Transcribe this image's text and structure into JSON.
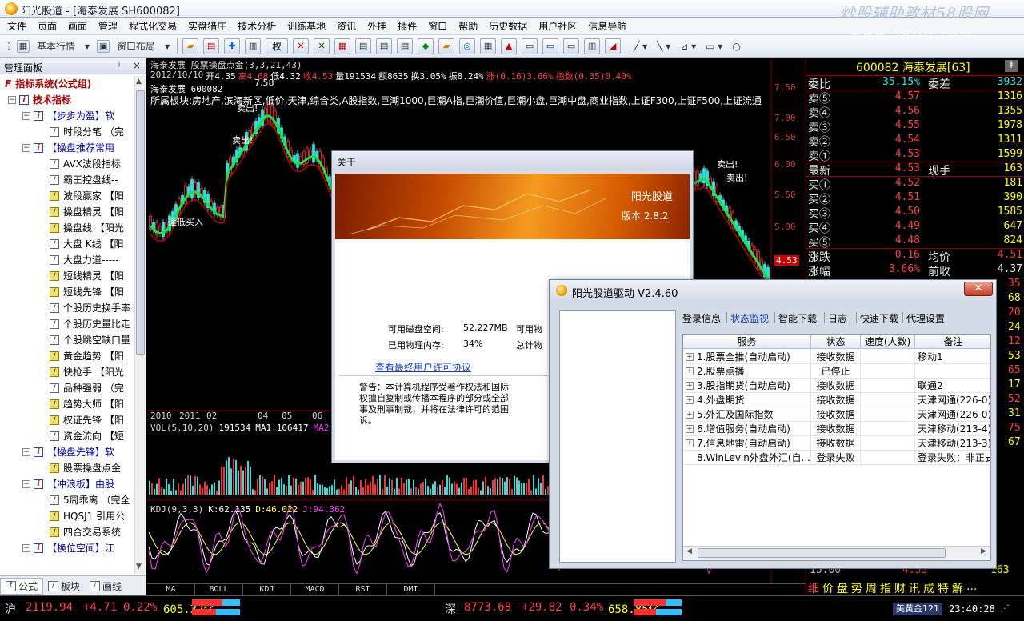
{
  "window": {
    "title": "阳光股道 - [海泰发展 SH600082]",
    "watermark1": "炒股辅助教材58股网",
    "watermark2": "www.58Gu.com"
  },
  "menu": [
    "文件",
    "页面",
    "画面",
    "管理",
    "程式化交易",
    "实盘猎庄",
    "技术分析",
    "训练基地",
    "资讯",
    "外挂",
    "插件",
    "窗口",
    "帮助",
    "历史数据",
    "用户社区",
    "信息导航"
  ],
  "toolbar": {
    "mode_label": "基本行情",
    "layout_label": "窗口布局",
    "quan_label": "权"
  },
  "left_panel": {
    "title": "管理面板",
    "pin": "ʲ",
    "close": "×",
    "tree": [
      {
        "label": "指标系统(公式组)",
        "level": 0,
        "icon": "F"
      },
      {
        "label": "技术指标",
        "level": 1,
        "icon": "i"
      },
      {
        "label": "【步步为盈】软",
        "level": 2,
        "icon": "i"
      },
      {
        "label": "时段分笔 （完",
        "level": 3,
        "icon": "box"
      },
      {
        "label": "【操盘推荐常用",
        "level": 2,
        "icon": "i"
      },
      {
        "label": "AVX波段指标",
        "level": 3,
        "icon": "box"
      },
      {
        "label": "霸王控盘线--",
        "level": 3,
        "icon": "box"
      },
      {
        "label": "波段赢家 【阳",
        "level": 3,
        "icon": "y"
      },
      {
        "label": "操盘精灵 【阳",
        "level": 3,
        "icon": "y"
      },
      {
        "label": "操盘线 【阳光",
        "level": 3,
        "icon": "y"
      },
      {
        "label": "大盘 K线 【阳",
        "level": 3,
        "icon": "box"
      },
      {
        "label": "大盘力道-----",
        "level": 3,
        "icon": "box"
      },
      {
        "label": "短线精灵 【阳",
        "level": 3,
        "icon": "y"
      },
      {
        "label": "短线先锋 【阳",
        "level": 3,
        "icon": "y"
      },
      {
        "label": "个股历史换手率",
        "level": 3,
        "icon": "box"
      },
      {
        "label": "个股历史量比走",
        "level": 3,
        "icon": "box"
      },
      {
        "label": "个股跳空缺口量",
        "level": 3,
        "icon": "box"
      },
      {
        "label": "黄金趋势 【阳",
        "level": 3,
        "icon": "y"
      },
      {
        "label": "快枪手 【阳光",
        "level": 3,
        "icon": "y"
      },
      {
        "label": "品种强弱 （完",
        "level": 3,
        "icon": "box"
      },
      {
        "label": "趋势大师 【阳",
        "level": 3,
        "icon": "y"
      },
      {
        "label": "权证先锋 【阳",
        "level": 3,
        "icon": "y"
      },
      {
        "label": "资金流向 【短",
        "level": 3,
        "icon": "box"
      },
      {
        "label": "【操盘先锋】软",
        "level": 2,
        "icon": "i"
      },
      {
        "label": "股票操盘点金",
        "level": 3,
        "icon": "y"
      },
      {
        "label": "【冲浪板】由股",
        "level": 2,
        "icon": "i"
      },
      {
        "label": "5周乖离 （完全",
        "level": 3,
        "icon": "box"
      },
      {
        "label": "HQSJ1 引用公",
        "level": 3,
        "icon": "y"
      },
      {
        "label": "四合交易系统",
        "level": 3,
        "icon": "y"
      },
      {
        "label": "【换位空间】江",
        "level": 2,
        "icon": "i"
      }
    ],
    "tabs": [
      "公式",
      "板块",
      "画线"
    ]
  },
  "chart": {
    "head1": "海泰发展  股票操盘点金(3,3,21,43)",
    "ohlc": [
      {
        "t": "2012/10/10",
        "c": "#d8d8d8"
      },
      {
        "t": "开4.35",
        "c": "#ffffff"
      },
      {
        "t": "高4.68",
        "c": "#ff4040"
      },
      {
        "t": "低4.32",
        "c": "#ffffff"
      },
      {
        "t": "收4.53",
        "c": "#ff4040"
      },
      {
        "t": "量191534",
        "c": "#ffffff"
      },
      {
        "t": "额8635",
        "c": "#ffffff"
      },
      {
        "t": "换3.05%",
        "c": "#ffffff"
      },
      {
        "t": "振8.24%",
        "c": "#ffffff"
      },
      {
        "t": "涨(0.16)3.66%",
        "c": "#ff4040"
      },
      {
        "t": "指数(0.35)0.40%",
        "c": "#ff4040"
      }
    ],
    "stock_line": "海泰发展 600082",
    "sector_line": "所属板块:房地产,滨海新区,低价,天津,综合类,A股指数,巨潮1000,巨潮A指,巨潮价值,巨潮小盘,巨潮中盘,商业指数,上证F300,上证F500,上证流通",
    "annotations": [
      {
        "t": "7.58"
      },
      {
        "t": "卖出!"
      },
      {
        "t": "卖出!"
      },
      {
        "t": "逢低买入"
      },
      {
        "t": "卖出!"
      },
      {
        "t": "卖出!"
      }
    ],
    "price_axis": [
      "7.50",
      "7.00",
      "6.50",
      "6.00",
      "5.50",
      "5.00",
      "4.53"
    ],
    "date_axis": [
      "2010",
      "2011",
      "02",
      "04",
      "05",
      "06"
    ],
    "vol_line": {
      "lbl": "VOL(5,10,20)",
      "v1": "191534",
      "ma1": "MA1:106417",
      "ma2": "MA2"
    },
    "kdj_line": {
      "lbl": "KDJ(9,3,3)",
      "k": "K:62.135",
      "d": "D:46.022",
      "j": "J:94.362"
    },
    "bottom_tabs": [
      "MA",
      "BOLL",
      "KDJ",
      "MACD",
      "RSI",
      "DMI"
    ]
  },
  "quote": {
    "title": "600082 海泰发展[63]",
    "weibi": {
      "lbl": "委比",
      "val": "-35.15%",
      "lbl2": "委差",
      "val2": "-3932"
    },
    "sells": [
      {
        "lbl": "卖⑤",
        "price": "4.57",
        "vol": "1316"
      },
      {
        "lbl": "卖④",
        "price": "4.56",
        "vol": "1355"
      },
      {
        "lbl": "卖③",
        "price": "4.55",
        "vol": "1978"
      },
      {
        "lbl": "卖②",
        "price": "4.54",
        "vol": "1311"
      },
      {
        "lbl": "卖①",
        "price": "4.53",
        "vol": "1599"
      }
    ],
    "latest": {
      "lbl": "最新",
      "price": "4.53",
      "lbl2": "现手",
      "vol": "163"
    },
    "buys": [
      {
        "lbl": "买①",
        "price": "4.52",
        "vol": "181"
      },
      {
        "lbl": "买②",
        "price": "4.51",
        "vol": "390"
      },
      {
        "lbl": "买③",
        "price": "4.50",
        "vol": "1585"
      },
      {
        "lbl": "买④",
        "price": "4.49",
        "vol": "647"
      },
      {
        "lbl": "买⑤",
        "price": "4.48",
        "vol": "824"
      }
    ],
    "change": {
      "lbl": "涨跌",
      "val": "0.16",
      "lbl2": "均价",
      "val2": "4.51"
    },
    "pct": {
      "lbl": "涨幅",
      "val": "3.66%",
      "lbl2": "前收",
      "val2": "4.37"
    },
    "tail_vals": [
      "35",
      "68",
      "20",
      "24",
      "12",
      "53",
      "65",
      "17",
      "52",
      "31",
      "75",
      "67"
    ],
    "bottom_time": "15:00",
    "bottom_price": "4.53",
    "bottom_vol": "163",
    "bottom_tabs": [
      "细",
      "价",
      "盘",
      "势",
      "周",
      "指",
      "财",
      "讯",
      "成",
      "特",
      "解",
      "..."
    ]
  },
  "status": {
    "sh_lbl": "沪",
    "sh_idx": "2119.94",
    "sh_chg": "+4.71",
    "sh_pct": "0.22%",
    "sh_amt": "605.32亿",
    "sz_lbl": "深",
    "sz_idx": "8773.68",
    "sz_chg": "+29.82",
    "sz_pct": "0.34%",
    "sz_amt": "658.85亿",
    "ticker": "美黄金121",
    "time": "23:40:28"
  },
  "about": {
    "title": "关于",
    "brand": "阳光股道",
    "version": "版本 2.8.2",
    "disk_lbl": "可用磁盘空间:",
    "disk_val": "52,227MB",
    "mem_lbl": "已用物理内存:",
    "mem_val": "34%",
    "avail_lbl": "可用物",
    "total_lbl": "总计物",
    "license_link": "查看最终用户许可协议",
    "warning": [
      "警告：本计算机程序受著作权法和国际",
      "权擅自复制或传播本程序的部分或全部",
      "事及刑事制裁，并将在法律许可的范围",
      "诉。"
    ]
  },
  "driver": {
    "title": "阳光股道驱动 V2.4.60",
    "close": "✕",
    "tabs": [
      "登录信息",
      "状态监视",
      "智能下载",
      "日志",
      "快速下载",
      "代理设置"
    ],
    "columns": [
      "服务",
      "状态",
      "速度(人数)",
      "备注"
    ],
    "rows": [
      {
        "name": "1.股票全推(自动启动)",
        "status": "接收数据",
        "speed": "",
        "note": "移动1",
        "plus": true
      },
      {
        "name": "2.股票点播",
        "status": "已停止",
        "speed": "",
        "note": "",
        "plus": true
      },
      {
        "name": "3.股指期货(自动启动)",
        "status": "接收数据",
        "speed": "",
        "note": "联通2",
        "plus": true
      },
      {
        "name": "4.外盘期货",
        "status": "接收数据",
        "speed": "",
        "note": "天津网通(226-0)",
        "plus": true
      },
      {
        "name": "5.外汇及国际指数",
        "status": "接收数据",
        "speed": "",
        "note": "天津网通(226-0)",
        "plus": true
      },
      {
        "name": "6.增值服务(自动启动)",
        "status": "接收数据",
        "speed": "",
        "note": "天津移动(213-4)",
        "plus": true
      },
      {
        "name": "7.信息地雷(自动启动)",
        "status": "接收数据",
        "speed": "",
        "note": "天津移动(213-3)",
        "plus": true
      },
      {
        "name": "8.WinLevin外盘外汇(自...",
        "status": "登录失败",
        "speed": "",
        "note": "登录失败：非正式",
        "plus": false
      }
    ]
  }
}
